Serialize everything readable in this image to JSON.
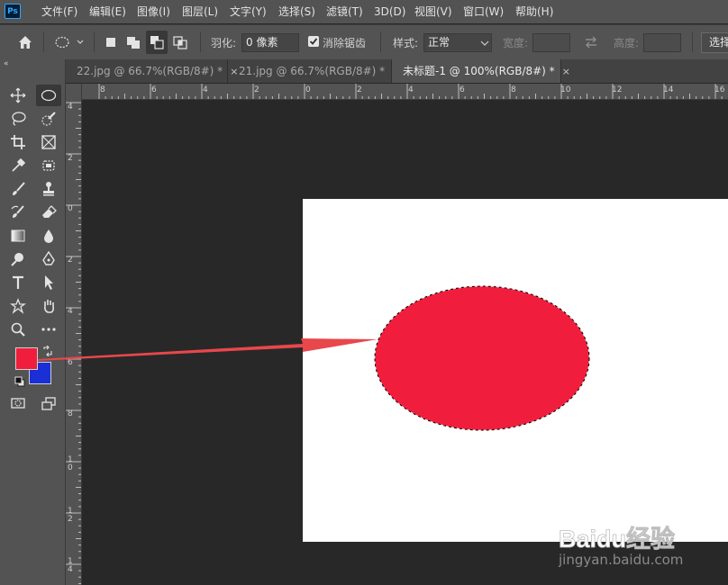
{
  "app": {
    "logo_text": "Ps"
  },
  "menu": [
    "文件(F)",
    "编辑(E)",
    "图像(I)",
    "图层(L)",
    "文字(Y)",
    "选择(S)",
    "滤镜(T)",
    "3D(D)",
    "视图(V)",
    "窗口(W)",
    "帮助(H)"
  ],
  "options": {
    "feather_label": "羽化:",
    "feather_value": "0 像素",
    "antialias_label": "消除锯齿",
    "antialias_checked": true,
    "style_label": "样式:",
    "style_value": "正常",
    "width_label": "宽度:",
    "height_label": "高度:",
    "select_mask_label": "选择"
  },
  "tabs": [
    {
      "label": "22.jpg @ 66.7%(RGB/8#) *",
      "close": "×",
      "active": false
    },
    {
      "label": "21.jpg @ 66.7%(RGB/8#) *",
      "close": "×",
      "active": false
    },
    {
      "label": "未标题-1 @ 100%(RGB/8#) *",
      "close": "×",
      "active": true
    }
  ],
  "rulers": {
    "top_ticks": [
      "8",
      "6",
      "4",
      "2",
      "0",
      "2",
      "4",
      "6",
      "8",
      "10",
      "12",
      "14",
      "16"
    ],
    "left_ticks": [
      "4",
      "2",
      "0",
      "2",
      "4",
      "6",
      "8",
      "1\n0",
      "1\n2",
      "1\n4"
    ]
  },
  "colors": {
    "foreground": "#f01e3c",
    "background": "#1a30d6",
    "ellipse_fill": "#f01e3c",
    "arrow": "#e8474c",
    "canvas": "#ffffff"
  },
  "watermark": {
    "logo_text": "Baidu经验",
    "url": "jingyan.baidu.com"
  }
}
